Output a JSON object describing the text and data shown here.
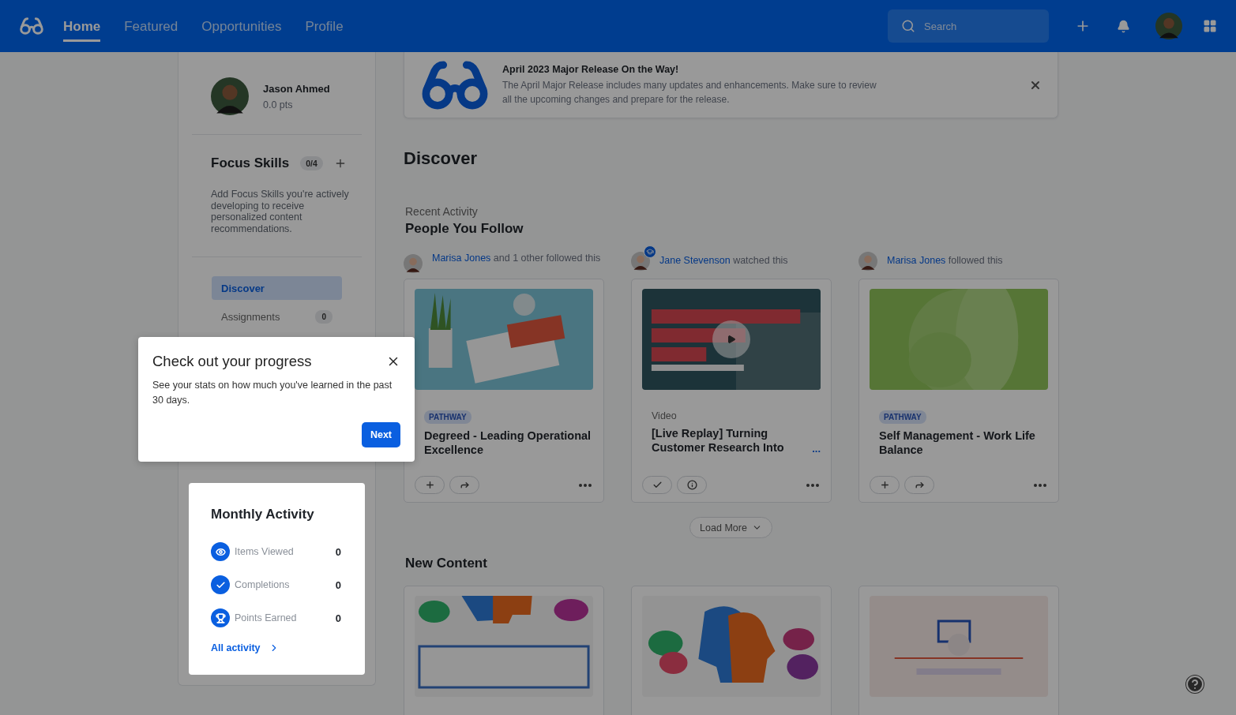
{
  "nav": {
    "tabs": [
      {
        "label": "Home",
        "selected": true
      },
      {
        "label": "Featured",
        "selected": false
      },
      {
        "label": "Opportunities",
        "selected": false
      },
      {
        "label": "Profile",
        "selected": false
      }
    ],
    "search": {
      "placeholder": "Search"
    }
  },
  "profile": {
    "name": "Jason Ahmed",
    "points": "0.0 pts"
  },
  "focus_skills": {
    "title": "Focus Skills",
    "count": "0/4",
    "description": "Add Focus Skills you're actively developing to receive personalized content recommendations."
  },
  "side_nav": [
    {
      "label": "Discover",
      "selected": true
    },
    {
      "label": "Assignments",
      "selected": false,
      "badge": "0"
    }
  ],
  "monthly_activity": {
    "title": "Monthly Activity",
    "stats": [
      {
        "kind": "viewed",
        "label": "Items Viewed",
        "value": "0"
      },
      {
        "kind": "completed",
        "label": "Completions",
        "value": "0"
      },
      {
        "kind": "points",
        "label": "Points Earned",
        "value": "0"
      }
    ],
    "link": "All activity"
  },
  "tooltip": {
    "title": "Check out your progress",
    "body": "See your stats on how much you've learned in the past 30 days.",
    "button": "Next"
  },
  "banner": {
    "title": "April 2023 Major Release On the Way!",
    "body": "The April Major Release includes many updates and enhancements. Make sure to review all the upcoming changes and prepare for the release."
  },
  "discover": {
    "title": "Discover",
    "subtitle": "Recent Activity",
    "section": "People You Follow",
    "activities": [
      {
        "actor": "Marisa Jones",
        "action": "and 1 other followed this",
        "academy_badge": false,
        "card": {
          "kind": "pathway",
          "type": "PATHWAY",
          "title": "Degreed - Leading Operational Excellence",
          "actions": [
            {
              "kind": "add"
            },
            {
              "kind": "share"
            }
          ]
        }
      },
      {
        "actor": "Jane Stevenson",
        "action": "watched this",
        "academy_badge": true,
        "card": {
          "kind": "video",
          "type": "Video",
          "title": "[Live Replay] Turning Customer Research Into",
          "more": "...",
          "actions": [
            {
              "kind": "complete"
            },
            {
              "kind": "info"
            }
          ]
        }
      },
      {
        "actor": "Marisa Jones",
        "action": "followed this",
        "academy_badge": false,
        "card": {
          "kind": "pathway",
          "type": "PATHWAY",
          "title": "Self Management - Work Life Balance",
          "actions": [
            {
              "kind": "add"
            },
            {
              "kind": "share"
            }
          ]
        }
      }
    ],
    "load_more": "Load More"
  },
  "new_content": {
    "title": "New Content"
  }
}
